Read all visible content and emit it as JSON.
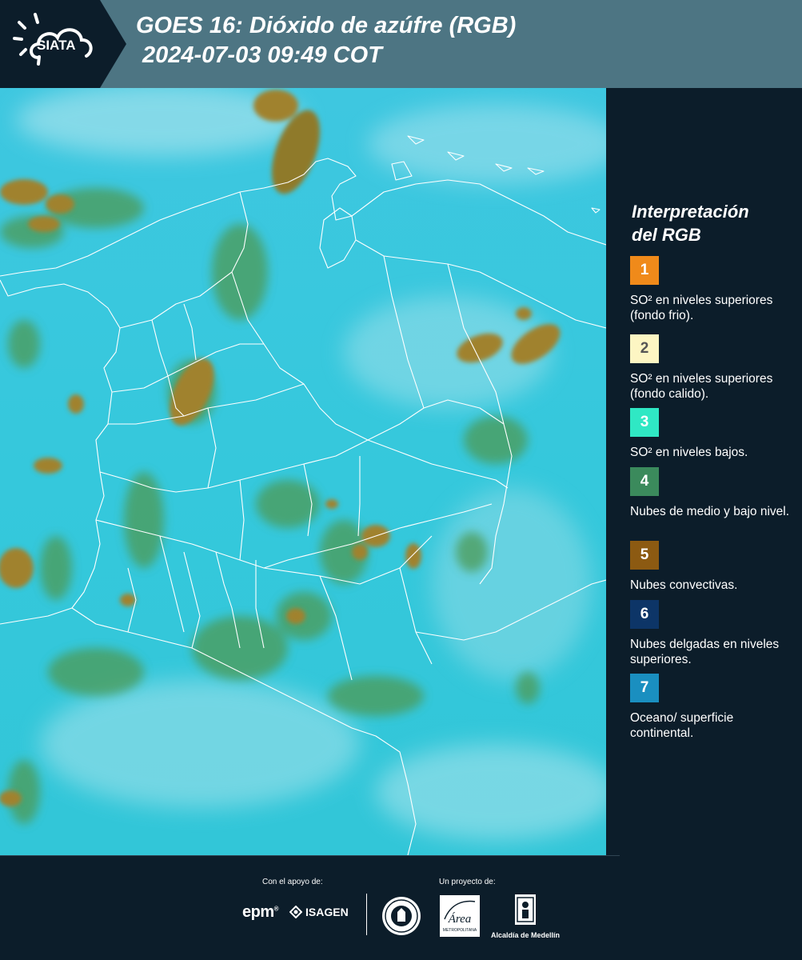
{
  "header": {
    "logo_text": "SIATA",
    "title_line1": "GOES 16: Dióxido de azúfre (RGB)",
    "title_line2": "2024-07-03 09:49 COT"
  },
  "legend": {
    "title_line1": "Interpretación",
    "title_line2": "del RGB",
    "items": [
      {
        "number": "1",
        "label": "SO² en niveles superiores (fondo frio).",
        "color": "#f08a1a",
        "text_color": "#ffffff"
      },
      {
        "number": "2",
        "label": "SO² en niveles superiores (fondo calido).",
        "color": "#fdf6c3",
        "text_color": "#555555"
      },
      {
        "number": "3",
        "label": "SO² en niveles bajos.",
        "color": "#2fe8c4",
        "text_color": "#ffffff"
      },
      {
        "number": "4",
        "label": "Nubes de medio y bajo nivel.",
        "color": "#3b8a5c",
        "text_color": "#ffffff"
      },
      {
        "number": "5",
        "label": "Nubes convectivas.",
        "color": "#8c5a12",
        "text_color": "#ffffff"
      },
      {
        "number": "6",
        "label": "Nubes delgadas en niveles superiores.",
        "color": "#0d3567",
        "text_color": "#ffffff"
      },
      {
        "number": "7",
        "label": "Oceano/ superficie continental.",
        "color": "#1a8fc0",
        "text_color": "#ffffff"
      }
    ]
  },
  "footer": {
    "support_label": "Con el apoyo de:",
    "project_label": "Un proyecto de:",
    "epm_text": "epm",
    "isagen_text": "ISAGEN",
    "area_text": "Área",
    "area_subtext": "METROPOLITANA",
    "alcaldia_text": "Alcaldía de Medellín"
  },
  "colors": {
    "header_bg": "#4d7583",
    "panel_bg": "#0c1d2a",
    "map_base": "#35c9dc",
    "convective": "#9a7a2a",
    "cloud_green": "#4f9a52"
  }
}
